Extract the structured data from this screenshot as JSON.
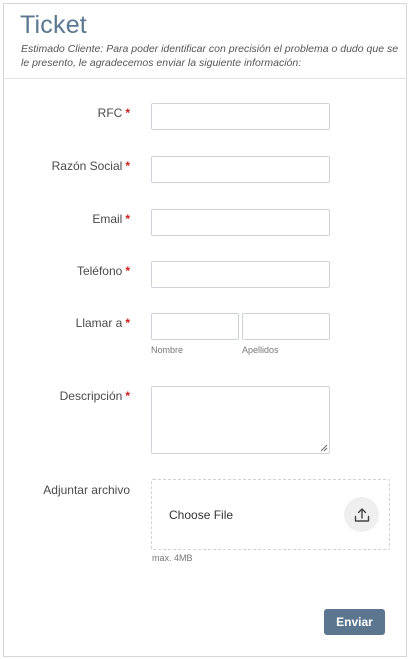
{
  "header": {
    "title": "Ticket",
    "subtitle": "Estimado Cliente: Para poder identificar con precisión el problema o dudo que se le presento, le agradecemos enviar la siguiente información:"
  },
  "form": {
    "required_mark": "*",
    "rfc_label": "RFC",
    "razon_label": "Razón Social",
    "email_label": "Email",
    "telefono_label": "Teléfono",
    "llamar_label": "Llamar a",
    "nombre_sublabel": "Nombre",
    "apellidos_sublabel": "Apellidos",
    "descripcion_label": "Descripción",
    "adjuntar_label": "Adjuntar archivo",
    "choose_file": "Choose File",
    "upload_icon": "upload-icon",
    "file_hint": "max. 4MB",
    "submit_label": "Enviar"
  },
  "colors": {
    "accent": "#5c7690",
    "title": "#5b7890",
    "required": "#d01f1f"
  }
}
